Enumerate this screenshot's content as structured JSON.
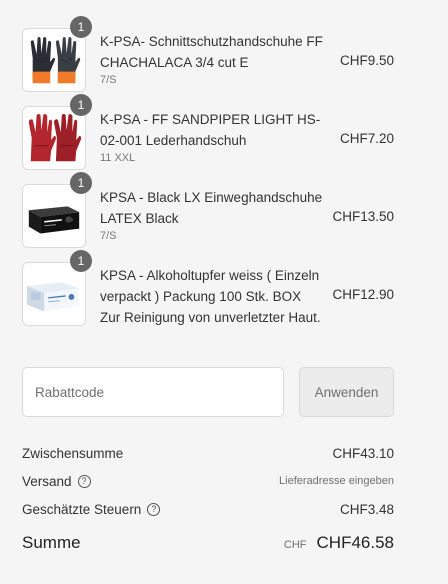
{
  "cart": {
    "items": [
      {
        "quantity": "1",
        "name": "K-PSA- Schnittschutzhandschuhe FF CHACHALACA 3/4 cut E",
        "variant": "7/S",
        "price": "CHF9.50",
        "image_icon": "black-orange-cut-gloves-image"
      },
      {
        "quantity": "1",
        "name": "K-PSA - FF SANDPIPER LIGHT HS-02-001 Lederhandschuh",
        "variant": "11 XXL",
        "price": "CHF7.20",
        "image_icon": "red-leather-gloves-image"
      },
      {
        "quantity": "1",
        "name": "KPSA - Black LX Einweghandschuhe LATEX Black",
        "variant": "7/S",
        "price": "CHF13.50",
        "image_icon": "black-latex-gloves-box-image"
      },
      {
        "quantity": "1",
        "name": "KPSA - Alkoholtupfer weiss ( Einzeln verpackt ) Packung 100 Stk. BOX Zur Reinigung von unverletzter Haut.",
        "variant": "",
        "price": "CHF12.90",
        "image_icon": "alcohol-swabs-box-image"
      }
    ]
  },
  "discount": {
    "placeholder": "Rabattcode",
    "apply_label": "Anwenden"
  },
  "summary": {
    "subtotal_label": "Zwischensumme",
    "subtotal_value": "CHF43.10",
    "shipping_label": "Versand",
    "shipping_value": "Lieferadresse eingeben",
    "taxes_label": "Geschätzte Steuern",
    "taxes_value": "CHF3.48",
    "total_label": "Summe",
    "total_currency": "CHF",
    "total_value": "CHF46.58",
    "help_glyph": "?"
  },
  "colors": {
    "background": "#f5f5f5",
    "badge": "#666666",
    "text": "#333333",
    "muted": "#707070"
  }
}
